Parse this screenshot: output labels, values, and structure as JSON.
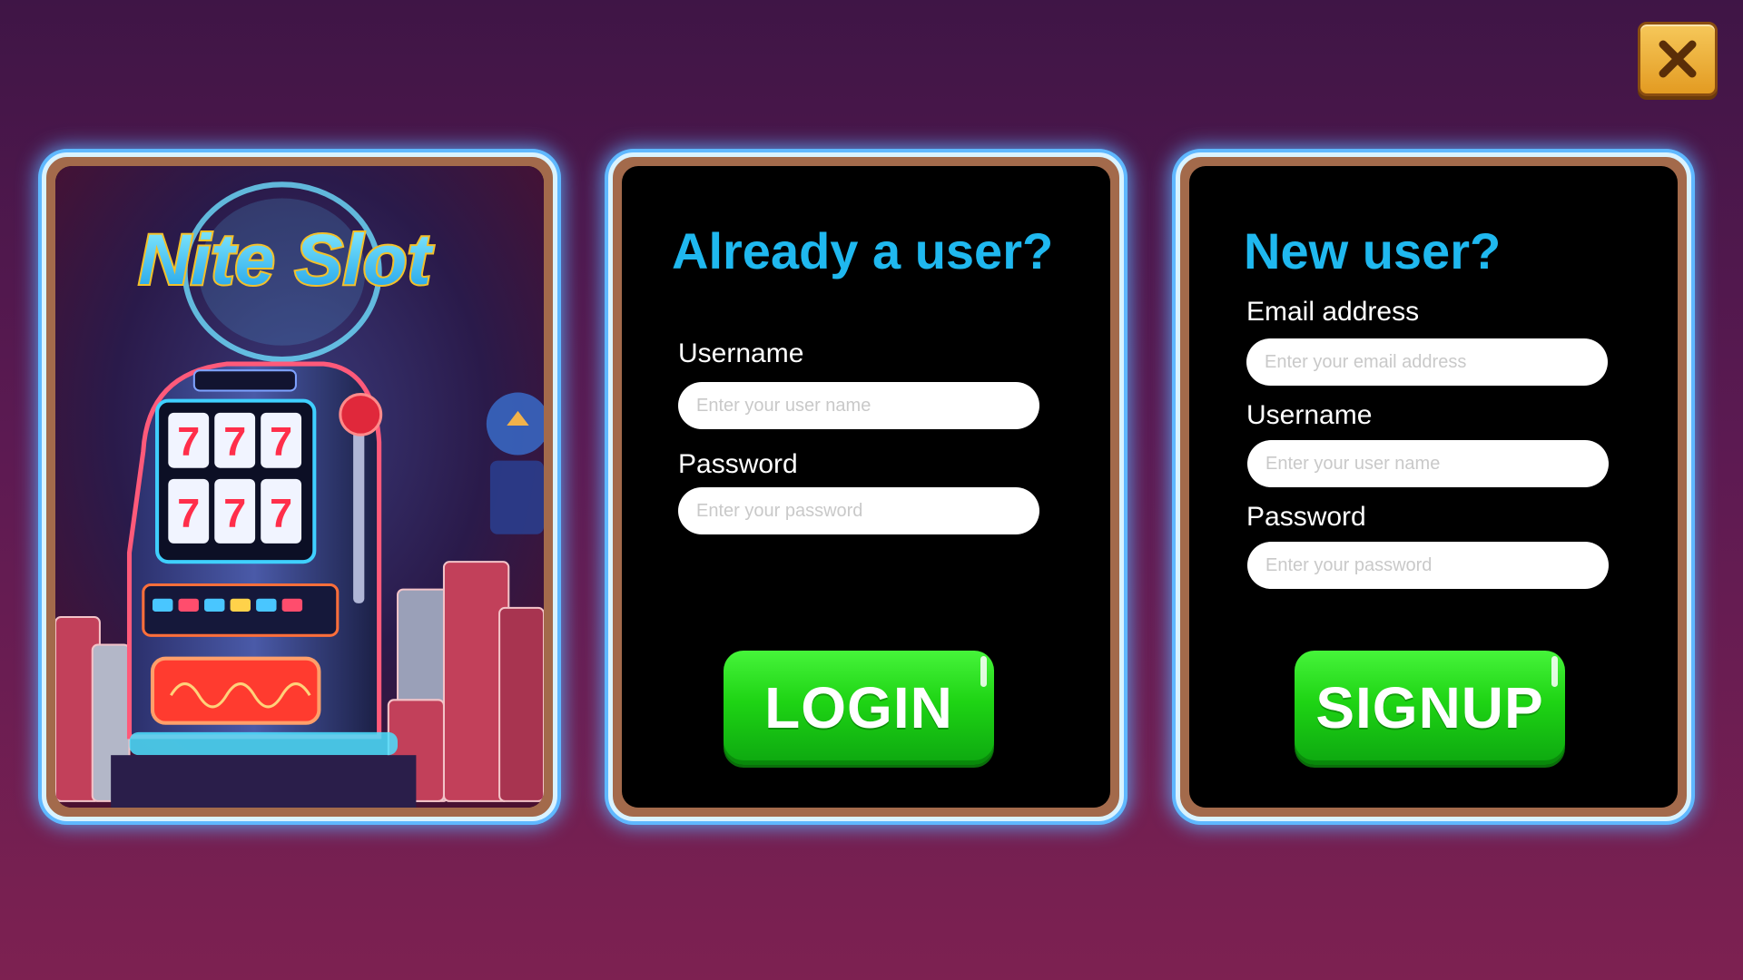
{
  "game": {
    "logo_text": "Nite Slot",
    "slot_reels": [
      "7",
      "7",
      "7",
      "7",
      "7",
      "7"
    ]
  },
  "close_button": {
    "icon": "close-icon"
  },
  "login": {
    "heading": "Already a user?",
    "username_label": "Username",
    "username_placeholder": "Enter your user name",
    "password_label": "Password",
    "password_placeholder": "Enter your password",
    "button_label": "LOGIN"
  },
  "signup": {
    "heading": "New user?",
    "email_label": "Email address",
    "email_placeholder": "Enter your email address",
    "username_label": "Username",
    "username_placeholder": "Enter your user name",
    "password_label": "Password",
    "password_placeholder": "Enter your password",
    "button_label": "SIGNUP"
  },
  "colors": {
    "heading": "#1fb8ef",
    "button_green": "#1ed414",
    "panel_frame": "#a36a4b",
    "panel_glow": "#5fb8ff",
    "close_gold": "#e39b22"
  }
}
